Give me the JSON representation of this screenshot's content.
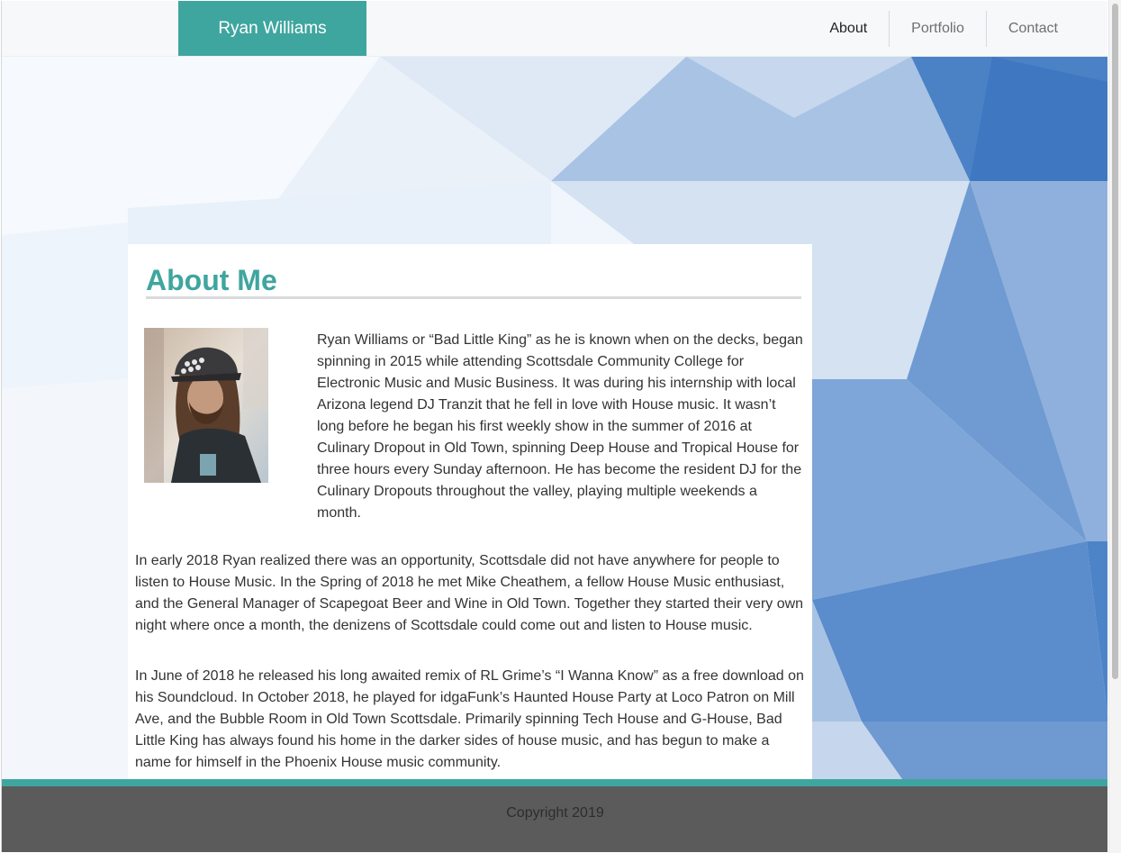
{
  "nav": {
    "brand": "Ryan Williams",
    "links": [
      {
        "label": "About",
        "active": true
      },
      {
        "label": "Portfolio",
        "active": false
      },
      {
        "label": "Contact",
        "active": false
      }
    ]
  },
  "about": {
    "title": "About Me",
    "paragraphs": [
      "Ryan Williams or “Bad Little King” as he is known when on the decks, began spinning in 2015 while attending Scottsdale Community College for Electronic Music and Music Business. It was during his internship with local Arizona legend DJ Tranzit that he fell in love with House music. It wasn’t long before he began his first weekly show in the summer of 2016 at Culinary Dropout in Old Town, spinning Deep House and Tropical House for three hours every Sunday afternoon. He has become the resident DJ for the Culinary Dropouts throughout the valley, playing multiple weekends a month.",
      "In early 2018 Ryan realized there was an opportunity, Scottsdale did not have anywhere for people to listen to House Music. In the Spring of 2018 he met Mike Cheathem, a fellow House Music enthusiast, and the General Manager of Scapegoat Beer and Wine in Old Town. Together they started their very own night where once a month, the denizens of Scottsdale could come out and listen to House music.",
      "In June of 2018 he released his long awaited remix of RL Grime’s “I Wanna Know” as a free download on his Soundcloud. In October 2018, he played for idgaFunk’s Haunted House Party at Loco Patron on Mill Ave, and the Bubble Room in Old Town Scottsdale. Primarily spinning Tech House and G-House, Bad Little King has always found his home in the darker sides of house music, and has begun to make a name for himself in the Phoenix House music community."
    ]
  },
  "footer": {
    "copyright": "Copyright 2019"
  },
  "colors": {
    "accent": "#3fa59f",
    "footer_bg": "#5b5b5b",
    "background_blue": "#3f7bc4"
  }
}
